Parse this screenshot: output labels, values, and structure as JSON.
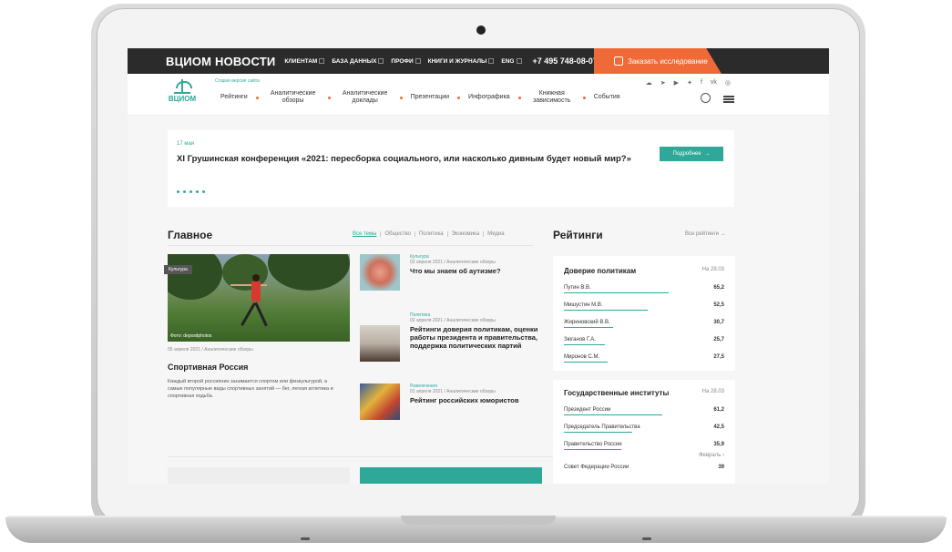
{
  "topbar": {
    "brand": "ВЦИОМ НОВОСТИ",
    "items": [
      "КЛИЕНТАМ",
      "БАЗА ДАННЫХ",
      "ПРОФИ",
      "КНИГИ И ЖУРНАЛЫ",
      "ENG"
    ],
    "phone": "+7 495 748-08-07",
    "order_label": "Заказать исследование"
  },
  "nav": {
    "logo_text": "ВЦИОМ",
    "old_version": "Старая версия сайта",
    "items": [
      "Рейтинги",
      "Аналитические обзоры",
      "Аналитические доклады",
      "Презентации",
      "Инфографика",
      "Книжная зависимость",
      "События"
    ]
  },
  "banner": {
    "date": "17 мая",
    "title": "XI Грушинская конференция «2021: пересборка социального, или насколько дивным будет новый мир?»",
    "button": "Подробнее"
  },
  "main": {
    "heading": "Главное",
    "filters": [
      "Все темы",
      "Общество",
      "Политика",
      "Экономика",
      "Медиа"
    ],
    "big_article": {
      "tag": "Культура",
      "photo_credit": "Фото: depositphotos",
      "meta": "05 апреля 2021 / Аналитические обзоры",
      "title": "Спортивная Россия",
      "desc": "Каждый второй россиянин занимается спортом или физкультурой, а самые популярные виды спортивных занятий — бег, легкая атлетика и спортивная ходьба."
    },
    "cards": [
      {
        "category": "Культура",
        "meta": "02 апреля 2021 / Аналитические обзоры",
        "title": "Что мы знаем об аутизме?"
      },
      {
        "category": "Политика",
        "meta": "02 апреля 2021 / Аналитические обзоры",
        "title": "Рейтинги доверия политикам, оценки работы президента и правительства, поддержка политических партий"
      },
      {
        "category": "Развлечения",
        "meta": "01 апреля 2021 / Аналитические обзоры",
        "title": "Рейтинг российских юмористов"
      }
    ]
  },
  "ratings": {
    "heading": "Рейтинги",
    "all_label": "Все рейтинги",
    "trust": {
      "title": "Доверие политикам",
      "date": "На 28.03",
      "rows": [
        {
          "name": "Путин В.В.",
          "value": "65,2",
          "pct": 0.652
        },
        {
          "name": "Мишустин М.В.",
          "value": "52,5",
          "pct": 0.525
        },
        {
          "name": "Жириновский В.В.",
          "value": "30,7",
          "pct": 0.307
        },
        {
          "name": "Зюганов Г.А.",
          "value": "25,7",
          "pct": 0.257
        },
        {
          "name": "Миронов С.М.",
          "value": "27,5",
          "pct": 0.275
        }
      ]
    },
    "institutes": {
      "title": "Государственные институты",
      "date": "На 28.03",
      "rows": [
        {
          "name": "Президент России",
          "value": "61,2",
          "pct": 0.612
        },
        {
          "name": "Председатель Правительства",
          "value": "42,5",
          "pct": 0.425
        },
        {
          "name": "Правительство России",
          "value": "35,9",
          "pct": 0.359
        }
      ],
      "month": "Февраль",
      "extra": {
        "name": "Совет Федерации России",
        "value": "39"
      }
    }
  }
}
